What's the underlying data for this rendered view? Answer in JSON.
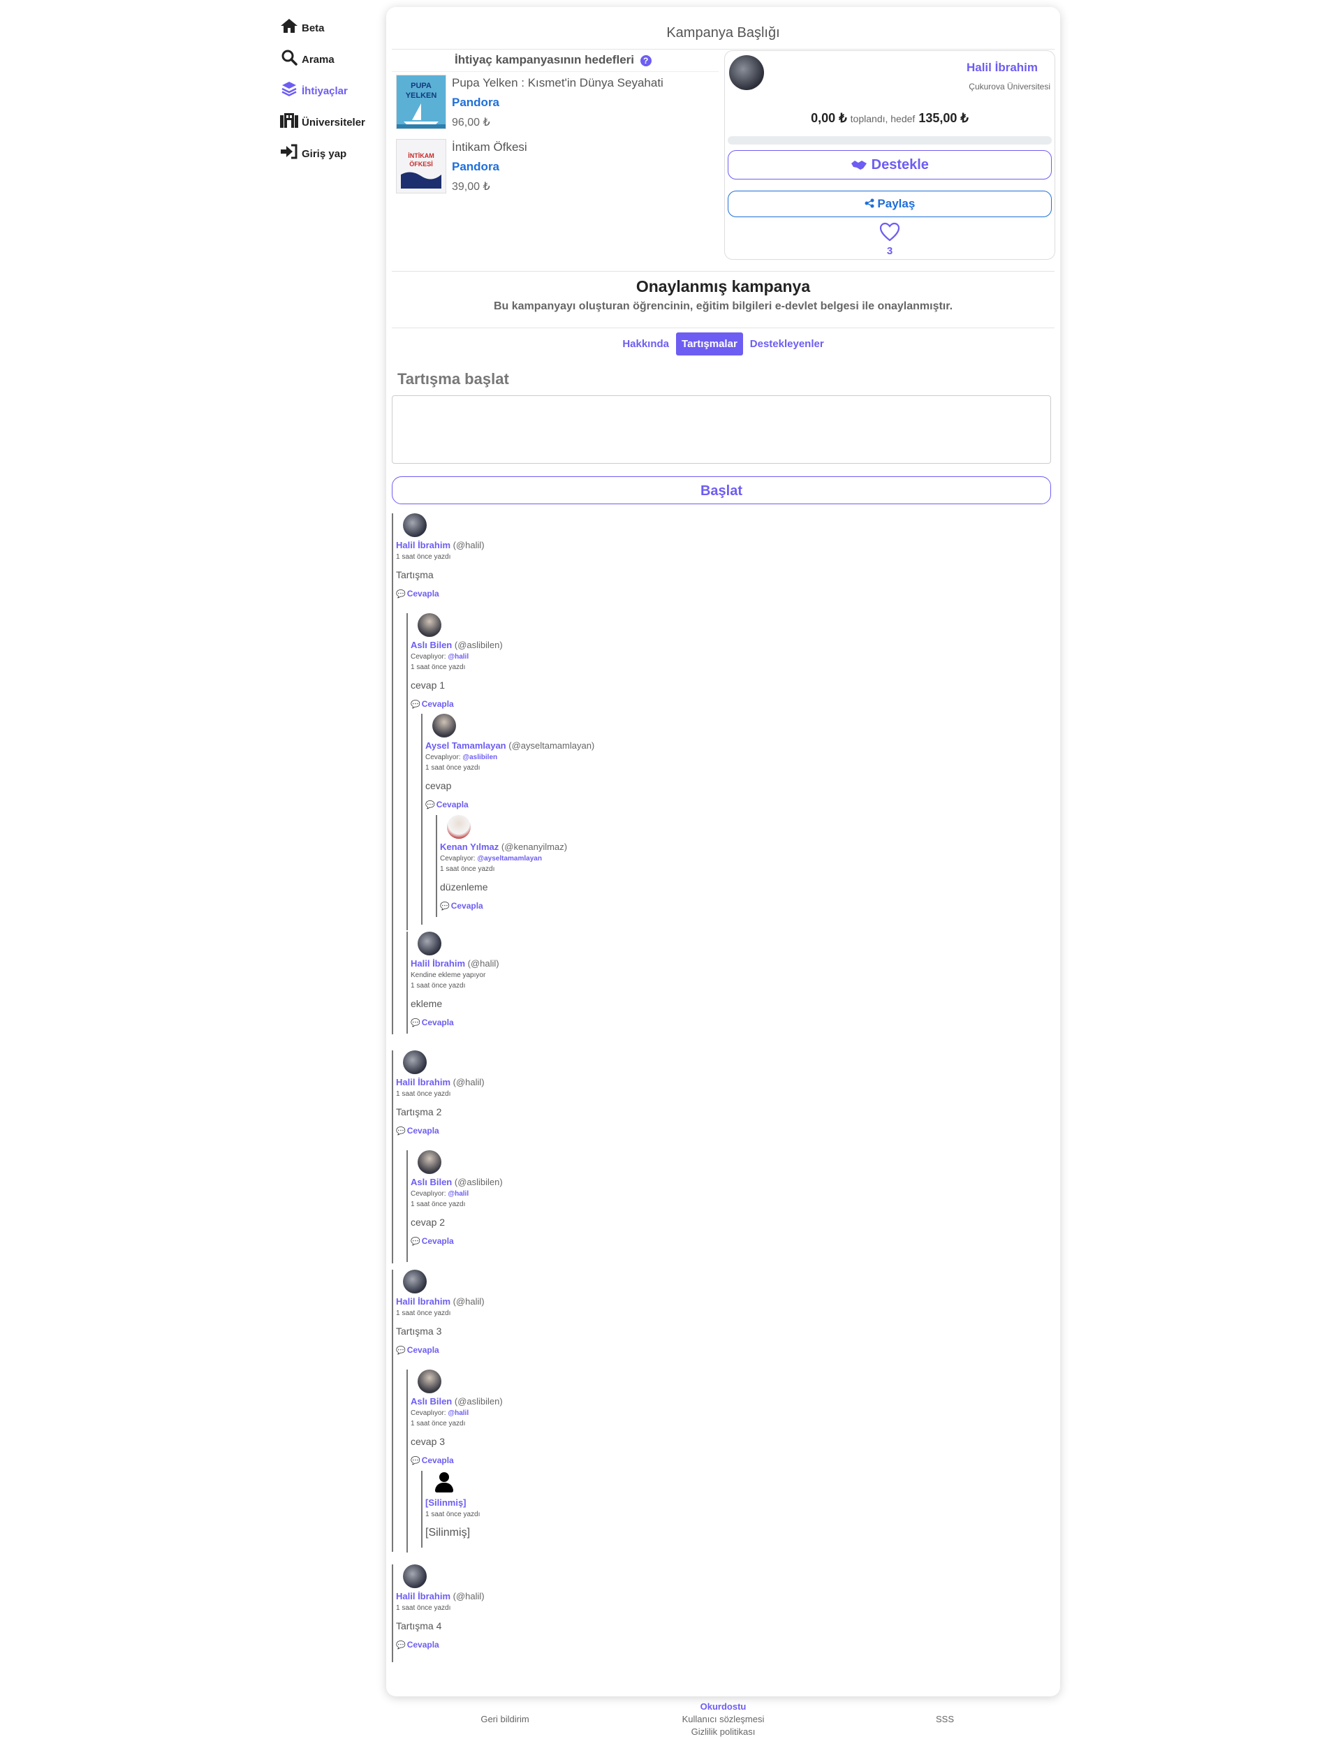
{
  "nav": [
    {
      "label": "Beta",
      "icon": "home-icon"
    },
    {
      "label": "Arama",
      "icon": "search-icon"
    },
    {
      "label": "İhtiyaçlar",
      "icon": "layers-icon"
    },
    {
      "label": "Üniversiteler",
      "icon": "university-icon"
    },
    {
      "label": "Giriş yap",
      "icon": "login-icon"
    }
  ],
  "campaign": {
    "title": "Kampanya Başlığı",
    "goals_heading": "İhtiyaç kampanyasının hedefleri",
    "books": [
      {
        "title": "Pupa Yelken : Kısmet'in Dünya Seyahati",
        "publisher": "Pandora",
        "price": "96,00 ₺",
        "cover_text": "PUPA YELKEN"
      },
      {
        "title": "İntikam Öfkesi",
        "publisher": "Pandora",
        "price": "39,00 ₺",
        "cover_text": "İNTİKAM ÖFKESİ"
      }
    ],
    "owner_name": "Halil İbrahim",
    "owner_university": "Çukurova Üniversitesi",
    "raised_amount": "0,00 ₺",
    "raised_label": "toplandı, hedef",
    "target_amount": "135,00 ₺",
    "progress": 0,
    "support_label": "Destekle",
    "share_label": "Paylaş",
    "likes": "3"
  },
  "approved": {
    "title": "Onaylanmış kampanya",
    "description": "Bu kampanyayı oluşturan öğrencinin, eğitim bilgileri e-devlet belgesi ile onaylanmıştır."
  },
  "tabs": [
    "Hakkında",
    "Tartışmalar",
    "Destekleyenler"
  ],
  "discussion": {
    "label": "Tartışma başlat",
    "button": "Başlat"
  },
  "comments": [
    {
      "name": "Halil İbrahim",
      "user": "(@halil)",
      "meta": "",
      "mention": "",
      "time": "1 saat önce yazdı",
      "text": "Tartışma",
      "reply": "Cevapla"
    },
    {
      "name": "Aslı Bilen",
      "user": "(@aslibilen)",
      "meta": "Cevaplıyor: ",
      "mention": "@halil",
      "time": "1 saat önce yazdı",
      "text": "cevap 1",
      "reply": "Cevapla"
    },
    {
      "name": "Aysel Tamamlayan",
      "user": "(@ayseltamamlayan)",
      "meta": "Cevaplıyor: ",
      "mention": "@aslibilen",
      "time": "1 saat önce yazdı",
      "text": "cevap",
      "reply": "Cevapla"
    },
    {
      "name": "Kenan Yılmaz",
      "user": "(@kenanyilmaz)",
      "meta": "Cevaplıyor: ",
      "mention": "@ayseltamamlayan",
      "time": "1 saat önce yazdı",
      "text": "düzenleme",
      "reply": "Cevapla"
    },
    {
      "name": "Halil İbrahim",
      "user": "(@halil)",
      "meta": "Kendine ekleme yapıyor",
      "mention": "",
      "time": "1 saat önce yazdı",
      "text": "ekleme",
      "reply": "Cevapla"
    },
    {
      "name": "Halil İbrahim",
      "user": "(@halil)",
      "meta": "",
      "mention": "",
      "time": "1 saat önce yazdı",
      "text": "Tartışma 2",
      "reply": "Cevapla"
    },
    {
      "name": "Aslı Bilen",
      "user": "(@aslibilen)",
      "meta": "Cevaplıyor: ",
      "mention": "@halil",
      "time": "1 saat önce yazdı",
      "text": "cevap 2",
      "reply": "Cevapla"
    },
    {
      "name": "Halil İbrahim",
      "user": "(@halil)",
      "meta": "",
      "mention": "",
      "time": "1 saat önce yazdı",
      "text": "Tartışma 3",
      "reply": "Cevapla"
    },
    {
      "name": "Aslı Bilen",
      "user": "(@aslibilen)",
      "meta": "Cevaplıyor: ",
      "mention": "@halil",
      "time": "1 saat önce yazdı",
      "text": "cevap 3",
      "reply": "Cevapla"
    },
    {
      "name": "[Silinmiş]",
      "user": "",
      "meta": "",
      "mention": "",
      "time": "1 saat önce yazdı",
      "text": "[Silinmiş]",
      "reply": ""
    },
    {
      "name": "Halil İbrahim",
      "user": "(@halil)",
      "meta": "",
      "mention": "",
      "time": "1 saat önce yazdı",
      "text": "Tartışma 4",
      "reply": "Cevapla"
    }
  ],
  "footer": {
    "feedback": "Geri bildirim",
    "brand": "Okurdostu",
    "terms": "Kullanıcı sözleşmesi",
    "privacy": "Gizlilik politikası",
    "faq": "SSS"
  },
  "colors": {
    "accent": "#6d5df2",
    "link": "#1e6fd9"
  }
}
